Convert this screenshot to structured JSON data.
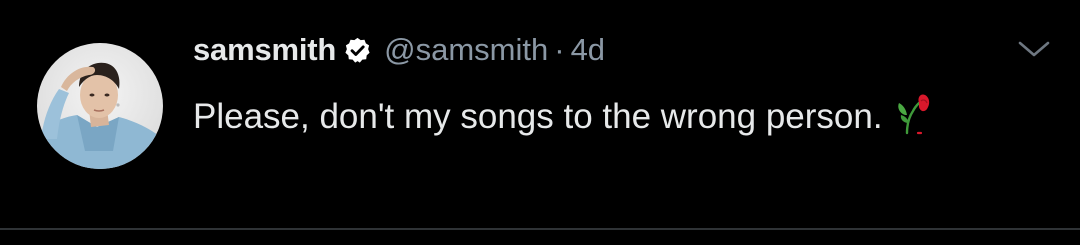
{
  "tweet": {
    "display_name": "samsmith",
    "handle": "@samsmith",
    "separator": "·",
    "time": "4d",
    "text": "Please, don't my songs to the wrong person.",
    "emoji": "wilted-rose-icon",
    "verified": true
  },
  "icons": {
    "verified": "verified-badge-icon",
    "menu": "chevron-down-icon",
    "avatar": "avatar"
  },
  "colors": {
    "background": "#000000",
    "text": "#e7e9ea",
    "muted": "#8b98a5",
    "divider": "#2f3336",
    "rose": "#d9182b"
  }
}
